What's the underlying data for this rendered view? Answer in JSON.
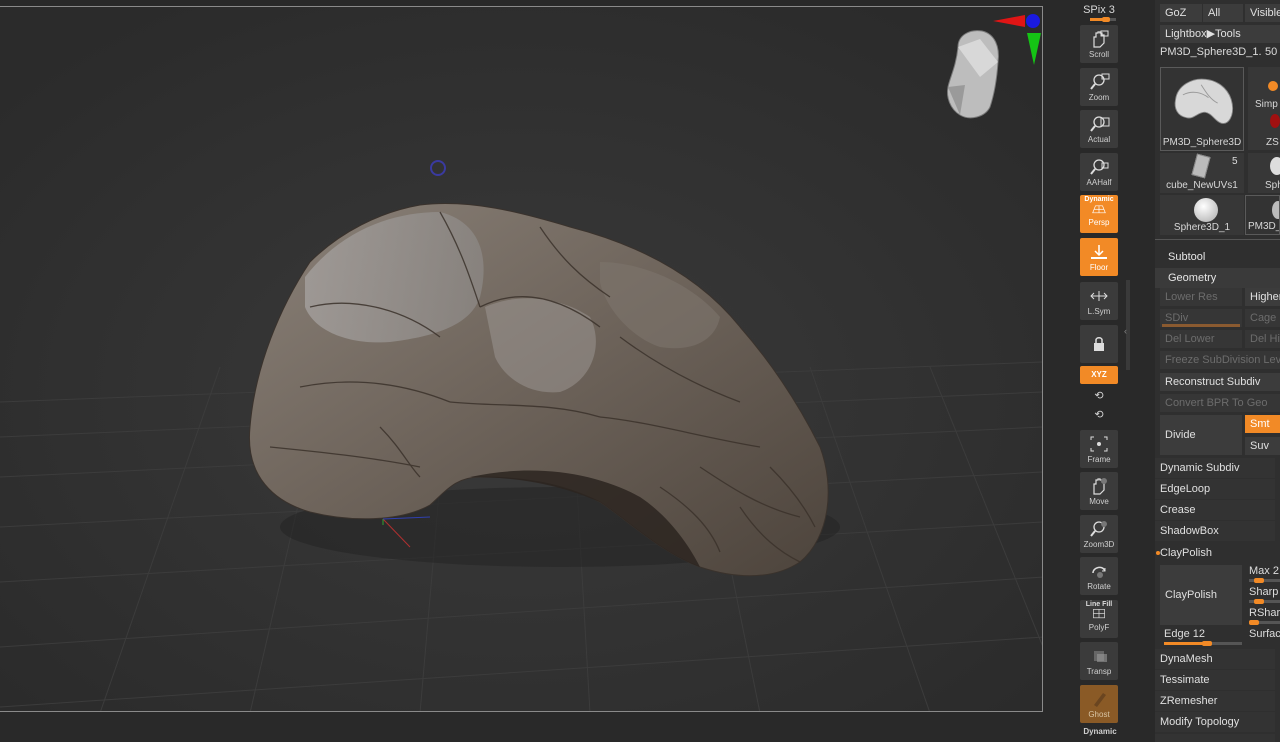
{
  "shelf": {
    "spix": "SPix 3",
    "spix_level": 0.6,
    "buttons": {
      "scroll": "Scroll",
      "zoom": "Zoom",
      "actual": "Actual",
      "aahalf": "AAHalf",
      "persp_top": "Dynamic",
      "persp": "Persp",
      "floor": "Floor",
      "lsym": "L.Sym",
      "xyz": "XYZ",
      "frame": "Frame",
      "move": "Move",
      "zoom3d": "Zoom3D",
      "rotate": "Rotate",
      "polyf_top": "Line Fill",
      "polyf": "PolyF",
      "transp": "Transp",
      "ghost": "Ghost",
      "dynamic": "Dynamic"
    }
  },
  "panel": {
    "top_buttons": [
      "GoZ",
      "All",
      "Visible"
    ],
    "lightbox": "Lightbox▶Tools",
    "current_tool": "PM3D_Sphere3D_1.",
    "current_tool_count": "50",
    "tools": [
      {
        "name": "PM3D_Sphere3D"
      },
      {
        "name": "Simp"
      },
      {
        "name": "ZS"
      },
      {
        "name": "cube_NewUVs1",
        "badge": "5"
      },
      {
        "name": "Sph"
      },
      {
        "name": "Sphere3D_1"
      },
      {
        "name": "PM3D_"
      }
    ],
    "subtool": "Subtool",
    "geometry": {
      "title": "Geometry",
      "lower_res": "Lower Res",
      "higher_res": "Higher",
      "sdiv": "SDiv",
      "cage": "Cage",
      "del_lower": "Del Lower",
      "del_higher": "Del Hi",
      "freeze": "Freeze SubDivision Leve",
      "reconstruct": "Reconstruct Subdiv",
      "convert_bpr": "Convert BPR To Geo",
      "divide": "Divide",
      "smt": "Smt",
      "suv": "Suv"
    },
    "sections": {
      "dynamic_subdiv": "Dynamic Subdiv",
      "edgeloop": "EdgeLoop",
      "crease": "Crease",
      "shadowbox": "ShadowBox",
      "claypolish": "ClayPolish",
      "claypolish_btn": "ClayPolish",
      "max": "Max 2",
      "sharp": "Sharp",
      "rsharp": "RSharp",
      "edge": "Edge 12",
      "surface": "Surfac",
      "dynamesh": "DynaMesh",
      "tessimate": "Tessimate",
      "zremesher": "ZRemesher",
      "modify_topology": "Modify Topology"
    }
  }
}
